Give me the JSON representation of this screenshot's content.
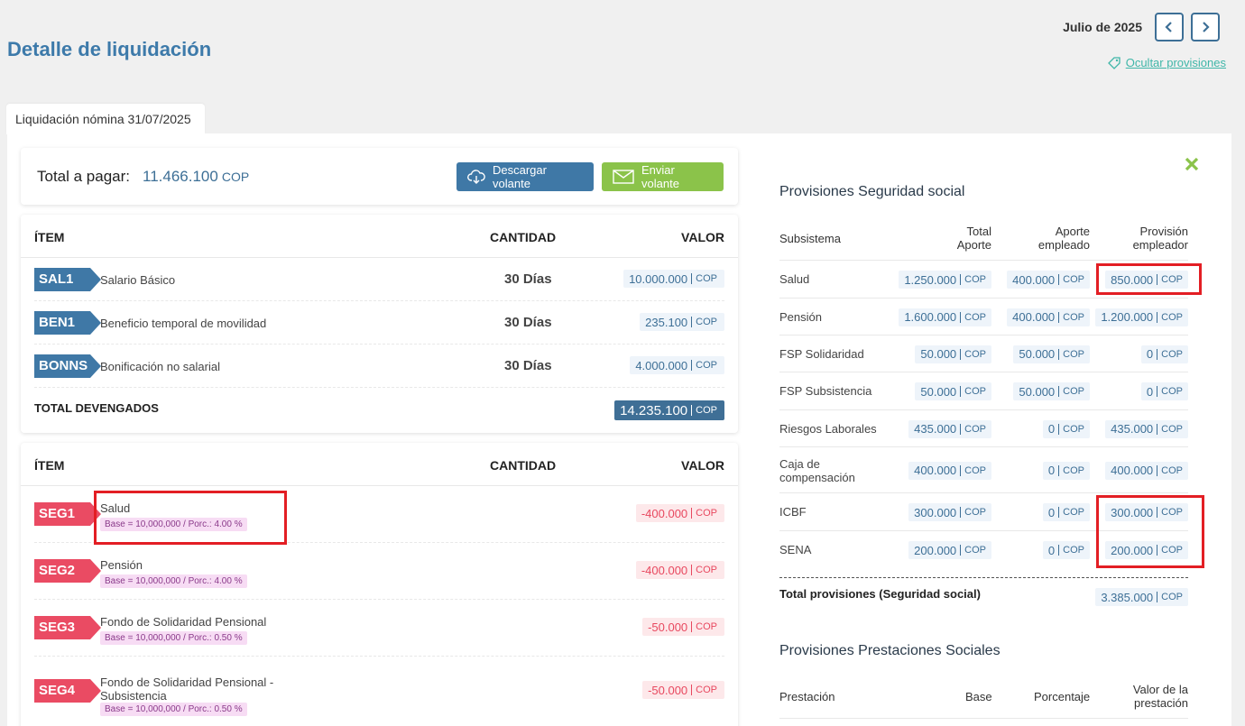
{
  "header": {
    "title": "Detalle de liquidación",
    "period": "Julio de 2025",
    "prev_icon": "chevron-left-icon",
    "next_icon": "chevron-right-icon",
    "hide_provisions": "Ocultar provisiones"
  },
  "tab": {
    "label": "Liquidación nómina 31/07/2025"
  },
  "summary": {
    "total_label": "Total a pagar:",
    "total_value": "11.466.100",
    "currency": "COP",
    "download_label": "Descargar volante",
    "send_label": "Enviar volante"
  },
  "earnings": {
    "col_item": "ÍTEM",
    "col_qty": "CANTIDAD",
    "col_value": "VALOR",
    "rows": [
      {
        "code": "SAL1",
        "desc": "Salario Básico",
        "qty": "30 Días",
        "value": "10.000.000",
        "cur": "COP"
      },
      {
        "code": "BEN1",
        "desc": "Beneficio temporal de movilidad",
        "qty": "30 Días",
        "value": "235.100",
        "cur": "COP"
      },
      {
        "code": "BONNS",
        "desc": "Bonificación no salarial",
        "qty": "30 Días",
        "value": "4.000.000",
        "cur": "COP"
      }
    ],
    "total_label": "TOTAL DEVENGADOS",
    "total_value": "14.235.100",
    "total_cur": "COP"
  },
  "deductions": {
    "col_item": "ÍTEM",
    "col_qty": "CANTIDAD",
    "col_value": "VALOR",
    "rows": [
      {
        "code": "SEG1",
        "desc": "Salud",
        "detail": "Base = 10,000,000 / Porc.: 4.00 %",
        "value": "-400.000",
        "cur": "COP"
      },
      {
        "code": "SEG2",
        "desc": "Pensión",
        "detail": "Base = 10,000,000 / Porc.: 4.00 %",
        "value": "-400.000",
        "cur": "COP"
      },
      {
        "code": "SEG3",
        "desc": "Fondo de Solidaridad Pensional",
        "detail": "Base = 10,000,000 / Porc.: 0.50 %",
        "value": "-50.000",
        "cur": "COP"
      },
      {
        "code": "SEG4",
        "desc": "Fondo de Solidaridad Pensional - Subsistencia",
        "detail": "Base = 10,000,000 / Porc.: 0.50 %",
        "value": "-50.000",
        "cur": "COP"
      }
    ]
  },
  "provisions_ss": {
    "title": "Provisiones Seguridad social",
    "col_subsystem": "Subsistema",
    "col_total": "Total Aporte",
    "col_employee": "Aporte empleado",
    "col_employer": "Provisión empleador",
    "currency": "COP",
    "rows": [
      {
        "name": "Salud",
        "total": "1.250.000",
        "employee": "400.000",
        "employer": "850.000"
      },
      {
        "name": "Pensión",
        "total": "1.600.000",
        "employee": "400.000",
        "employer": "1.200.000"
      },
      {
        "name": "FSP Solidaridad",
        "total": "50.000",
        "employee": "50.000",
        "employer": "0"
      },
      {
        "name": "FSP Subsistencia",
        "total": "50.000",
        "employee": "50.000",
        "employer": "0"
      },
      {
        "name": "Riesgos Laborales",
        "total": "435.000",
        "employee": "0",
        "employer": "435.000"
      },
      {
        "name": "Caja de compensación",
        "total": "400.000",
        "employee": "0",
        "employer": "400.000"
      },
      {
        "name": "ICBF",
        "total": "300.000",
        "employee": "0",
        "employer": "300.000"
      },
      {
        "name": "SENA",
        "total": "200.000",
        "employee": "0",
        "employer": "200.000"
      }
    ],
    "total_label": "Total provisiones (Seguridad social)",
    "total_value": "3.385.000"
  },
  "provisions_benefits": {
    "title": "Provisiones Prestaciones Sociales",
    "col_benefit": "Prestación",
    "col_base": "Base",
    "col_percent": "Porcentaje",
    "col_value": "Valor de la prestación"
  },
  "colors": {
    "brand_blue": "#3f78a6",
    "accent_green": "#8bc34a",
    "deduction_red": "#ea4b63",
    "highlight_red": "#e31e24"
  }
}
